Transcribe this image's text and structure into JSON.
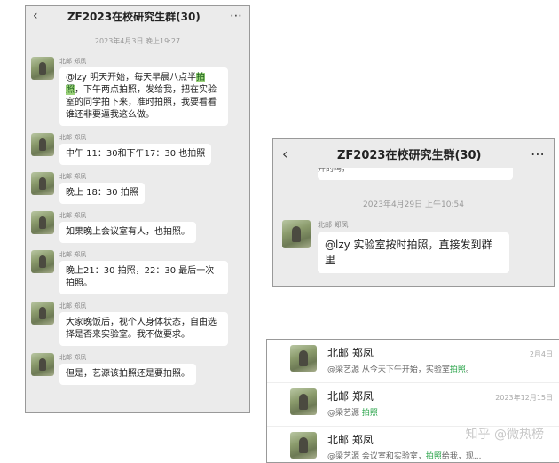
{
  "left": {
    "title": "ZF2023在校研究生群(30)",
    "back_icon": "chevron-left-icon",
    "more_icon": "more-icon",
    "timestamp": "2023年4月3日 晚上19:27",
    "sender": "北邮 郑凤",
    "messages": [
      {
        "pre": "@lzy 明天开始，每天早晨八点半",
        "hl": "拍照",
        "post": "，下午两点拍照，发给我，把在实验室的同学拍下来，准时拍照，我要看看谁还非要逼我这么做。"
      },
      {
        "pre": "中午 11：30和下午17：30 也拍照",
        "hl": "",
        "post": ""
      },
      {
        "pre": "晚上 18：30 拍照",
        "hl": "",
        "post": ""
      },
      {
        "pre": "如果晚上会议室有人，也拍照。",
        "hl": "",
        "post": ""
      },
      {
        "pre": "晚上21：30 拍照，22：30 最后一次拍照。",
        "hl": "",
        "post": ""
      },
      {
        "pre": "大家晚饭后，视个人身体状态，自由选择是否来实验室。我不做要求。",
        "hl": "",
        "post": ""
      },
      {
        "pre": "但是，艺源该拍照还是要拍照。",
        "hl": "",
        "post": ""
      }
    ]
  },
  "right_top": {
    "title": "ZF2023在校研究生群(30)",
    "back_icon": "chevron-left-icon",
    "more_icon": "more-icon",
    "cut_text": "开的吗，",
    "timestamp": "2023年4月29日 上午10:54",
    "sender": "北邮 郑凤",
    "message": "@lzy 实验室按时拍照，直接发到群里"
  },
  "right_bottom": {
    "rows": [
      {
        "name": "北邮 郑凤",
        "date": "2月4日",
        "pre": "@梁艺源 从今天下午开始，实验室",
        "kw": "拍照",
        "post": "。"
      },
      {
        "name": "北邮 郑凤",
        "date": "2023年12月15日",
        "pre": "@梁艺源 ",
        "kw": "拍照",
        "post": ""
      },
      {
        "name": "北邮 郑凤",
        "date": "",
        "pre": "@梁艺源 会议室和实验室，",
        "kw": "拍照",
        "post": "给我，现..."
      }
    ],
    "watermark": "知乎 @微热榜"
  }
}
